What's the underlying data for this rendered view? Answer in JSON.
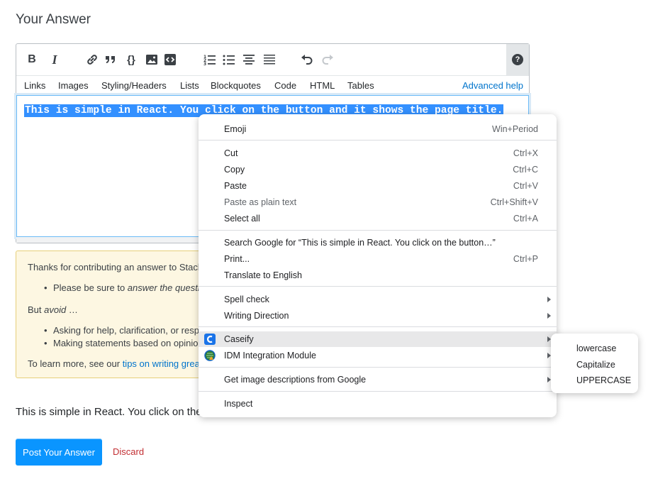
{
  "page": {
    "title": "Your Answer"
  },
  "toolbar": {
    "buttons": [
      "bold-icon",
      "italic-icon",
      "link-icon",
      "quote-icon",
      "code-icon",
      "image-icon",
      "snippet-icon",
      "ordered-list-icon",
      "unordered-list-icon",
      "heading-icon",
      "horizontal-rule-icon",
      "undo-icon",
      "redo-icon",
      "help-icon"
    ],
    "help_glyph": "?"
  },
  "tabs": {
    "items": [
      "Links",
      "Images",
      "Styling/Headers",
      "Lists",
      "Blockquotes",
      "Code",
      "HTML",
      "Tables"
    ],
    "advanced_help": "Advanced help"
  },
  "editor": {
    "selected_text": "This is simple in React. You click on the button and it shows the page title."
  },
  "notice": {
    "intro": "Thanks for contributing an answer to Stack",
    "bullet1_prefix": "Please be sure to ",
    "bullet1_em": "answer the question",
    "but_prefix": "But ",
    "but_em": "avoid",
    "but_suffix": " …",
    "bullet2": "Asking for help, clarification, or respo",
    "bullet3": "Making statements based on opinion",
    "learn_prefix": "To learn more, see our ",
    "learn_link": "tips on writing grea"
  },
  "preview": {
    "text": "This is simple in React. You click on the"
  },
  "actions": {
    "post": "Post Your Answer",
    "discard": "Discard"
  },
  "context_menu": {
    "emoji": {
      "label": "Emoji",
      "shortcut": "Win+Period"
    },
    "cut": {
      "label": "Cut",
      "shortcut": "Ctrl+X"
    },
    "copy": {
      "label": "Copy",
      "shortcut": "Ctrl+C"
    },
    "paste": {
      "label": "Paste",
      "shortcut": "Ctrl+V"
    },
    "paste_plain": {
      "label": "Paste as plain text",
      "shortcut": "Ctrl+Shift+V"
    },
    "select_all": {
      "label": "Select all",
      "shortcut": "Ctrl+A"
    },
    "search_google": {
      "label": "Search Google for “This is simple in React. You click on the button…”"
    },
    "print": {
      "label": "Print...",
      "shortcut": "Ctrl+P"
    },
    "translate": {
      "label": "Translate to English"
    },
    "spell_check": {
      "label": "Spell check"
    },
    "writing_direction": {
      "label": "Writing Direction"
    },
    "caseify": {
      "label": "Caseify"
    },
    "idm": {
      "label": "IDM Integration Module"
    },
    "image_desc": {
      "label": "Get image descriptions from Google"
    },
    "inspect": {
      "label": "Inspect"
    }
  },
  "submenu": {
    "items": [
      "lowercase",
      "Capitalize",
      "UPPERCASE"
    ]
  },
  "colors": {
    "accent": "#0a95ff",
    "link": "#0074cc",
    "selection": "#3390ff",
    "notice_bg": "#fdf7e2",
    "discard": "#c22e32"
  }
}
